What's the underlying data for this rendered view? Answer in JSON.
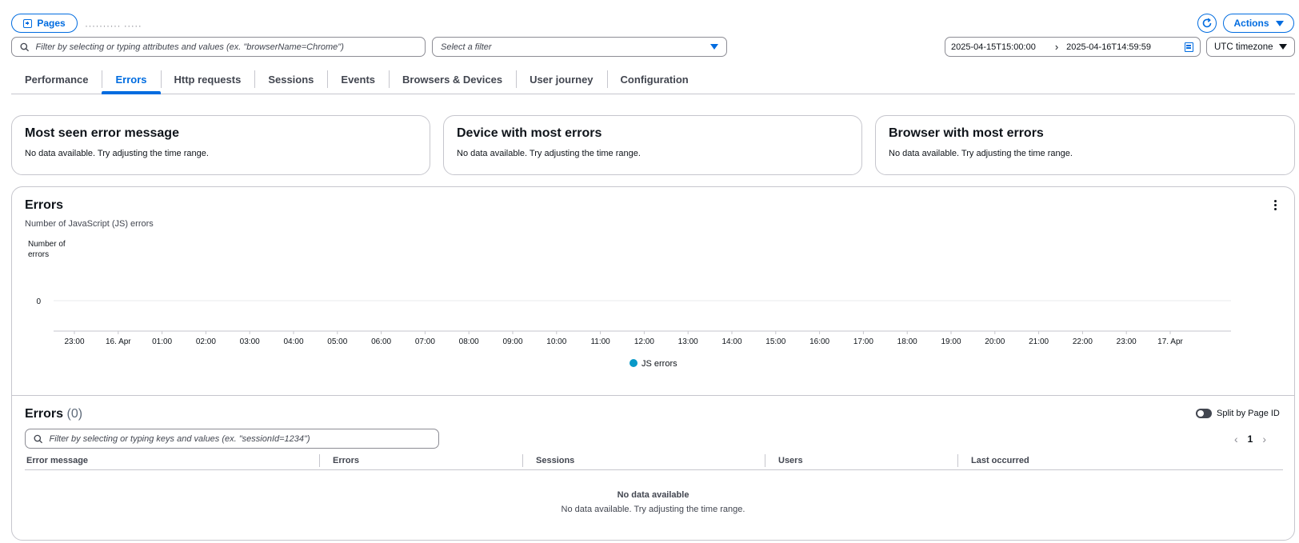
{
  "header": {
    "pages_label": "Pages",
    "app_name": "··········  ·····",
    "actions_label": "Actions"
  },
  "filter": {
    "placeholder": "Filter by selecting or typing attributes and values (ex. \"browserName=Chrome\")",
    "select_placeholder": "Select a filter"
  },
  "daterange": {
    "start": "2025-04-15T15:00:00",
    "end": "2025-04-16T14:59:59",
    "timezone": "UTC timezone"
  },
  "tabs": [
    {
      "label": "Performance"
    },
    {
      "label": "Errors"
    },
    {
      "label": "Http requests"
    },
    {
      "label": "Sessions"
    },
    {
      "label": "Events"
    },
    {
      "label": "Browsers & Devices"
    },
    {
      "label": "User journey"
    },
    {
      "label": "Configuration"
    }
  ],
  "active_tab": "Errors",
  "cards": [
    {
      "title": "Most seen error message",
      "text": "No data available. Try adjusting the time range."
    },
    {
      "title": "Device with most errors",
      "text": "No data available. Try adjusting the time range."
    },
    {
      "title": "Browser with most errors",
      "text": "No data available. Try adjusting the time range."
    }
  ],
  "chart": {
    "title": "Errors",
    "subtitle": "Number of JavaScript (JS) errors"
  },
  "chart_data": {
    "type": "line",
    "ylabel": "Number of errors",
    "yticks": [
      "0"
    ],
    "x": [
      "23:00",
      "16. Apr",
      "01:00",
      "02:00",
      "03:00",
      "04:00",
      "05:00",
      "06:00",
      "07:00",
      "08:00",
      "09:00",
      "10:00",
      "11:00",
      "12:00",
      "13:00",
      "14:00",
      "15:00",
      "16:00",
      "17:00",
      "18:00",
      "19:00",
      "20:00",
      "21:00",
      "22:00",
      "23:00",
      "17. Apr"
    ],
    "series": [
      {
        "name": "JS errors",
        "values": [],
        "color": "#0899c8"
      }
    ],
    "grid": true,
    "legend": "bottom"
  },
  "errors_table": {
    "title": "Errors",
    "count": "(0)",
    "split_label": "Split by Page ID",
    "search_placeholder": "Filter by selecting or typing keys and values (ex. \"sessionId=1234\")",
    "page": "1",
    "columns": [
      "Error message",
      "Errors",
      "Sessions",
      "Users",
      "Last occurred"
    ],
    "empty_title": "No data available",
    "empty_text": "No data available. Try adjusting the time range."
  },
  "colors": {
    "accent": "#006ce0",
    "border": "#c6c6cd",
    "series": "#0899c8"
  }
}
